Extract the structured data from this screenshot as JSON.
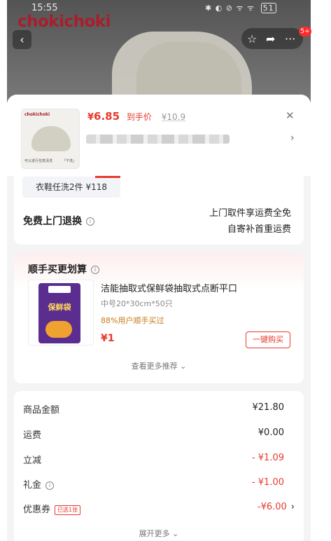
{
  "status_bar": {
    "time": "15:55",
    "indicators": "✱ ◐ ⊘ ᯤ ᯤ",
    "battery": "51"
  },
  "brand": {
    "logo_text": "chokichoki"
  },
  "header": {
    "badge_count": "5+"
  },
  "product": {
    "price_symbol": "¥",
    "price_value": "6.85",
    "price_tag": "到手价",
    "original_price": "¥10.9",
    "thumb_logo": "chokichoki",
    "thumb_caption_left": "可以进行任意清洗",
    "thumb_caption_right": "「干洗」"
  },
  "services": {
    "cloth_wash_label": "衣鞋任洗2件 ¥118",
    "return_title": "免费上门退换",
    "return_line1": "上门取件享运费全免",
    "return_line2": "自寄补首重运费"
  },
  "addon": {
    "section_title": "顺手买更划算",
    "item_name": "洁能抽取式保鲜袋抽取式点断平口",
    "item_spec": "中号20*30cm*50只",
    "item_stat": "88%用户顺手买过",
    "item_price": "¥1",
    "buy_button": "一键购买",
    "bag_label": "保鲜袋",
    "more_label": "查看更多推荐 ⌄"
  },
  "fees": {
    "subtotal_label": "商品金额",
    "subtotal_value": "¥21.80",
    "shipping_label": "运费",
    "shipping_value": "¥0.00",
    "discount_label": "立减",
    "discount_value": "- ¥1.09",
    "gift_label": "礼金",
    "gift_value": "- ¥1.00",
    "coupon_label": "优惠券",
    "coupon_tag": "已选1张",
    "coupon_value": "-¥6.00",
    "expand_label": "展开更多 ⌄"
  },
  "colors": {
    "accent": "#e8392e",
    "brand": "#a81e2c",
    "addon_stat": "#c77a1b"
  }
}
